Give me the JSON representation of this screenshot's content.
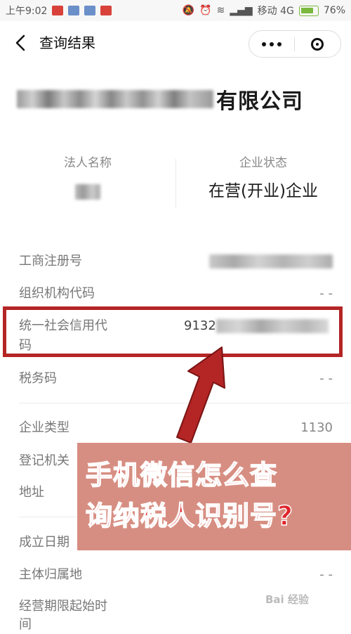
{
  "status_bar": {
    "time": "上午9:02",
    "carrier": "移动 4G",
    "battery": "76%"
  },
  "nav": {
    "title": "查询结果"
  },
  "company": {
    "name_visible_suffix": "有限公司"
  },
  "summary": {
    "legal_rep_label": "法人名称",
    "status_label": "企业状态",
    "status_value": "在营(开业)企业"
  },
  "fields": {
    "reg_no_label": "工商注册号",
    "org_code_label": "组织机构代码",
    "org_code_value": "- -",
    "credit_code_label_1": "统一社会信用代",
    "credit_code_label_2": "码",
    "credit_code_prefix": "9132",
    "tax_code_label": "税务码",
    "tax_code_value": "- -",
    "ent_type_label": "企业类型",
    "ent_type_value": "1130",
    "reg_authority_label": "登记机关",
    "address_label": "地址",
    "founded_label": "成立日期",
    "jurisdiction_label": "主体归属地",
    "jurisdiction_value": "- -",
    "term_start_label": "经营期限起始时",
    "term_start_label_2": "间"
  },
  "overlay": {
    "line1": "手机微信怎么查",
    "line2": "询纳税人识别号?"
  },
  "watermark": "Bai 经验",
  "colors": {
    "highlight_border": "#b42525",
    "overlay_bg": "#d78e82",
    "overlay_text": "#e0252a"
  }
}
